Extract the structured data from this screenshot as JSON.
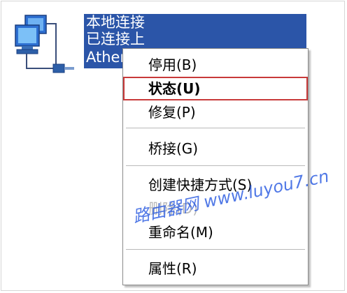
{
  "connection": {
    "name": "本地连接",
    "status": "已连接上",
    "adapter": "Ather"
  },
  "context_menu": {
    "items": [
      {
        "label": "停用(B)",
        "state": "normal"
      },
      {
        "label": "状态(U)",
        "state": "default"
      },
      {
        "label": "修复(P)",
        "state": "normal"
      },
      {
        "label": "桥接(G)",
        "state": "normal"
      },
      {
        "label": "创建快捷方式(S)",
        "state": "normal"
      },
      {
        "label": "删除(D)",
        "state": "disabled"
      },
      {
        "label": "重命名(M)",
        "state": "normal"
      },
      {
        "label": "属性(R)",
        "state": "normal"
      }
    ]
  },
  "watermark": "路由器网 www.luyou7.cn",
  "colors": {
    "selection_bg": "#2b55a8",
    "highlight_border": "#c83a3a",
    "watermark": "#1f53e0"
  },
  "icons": {
    "connection": "network-connection-icon"
  }
}
